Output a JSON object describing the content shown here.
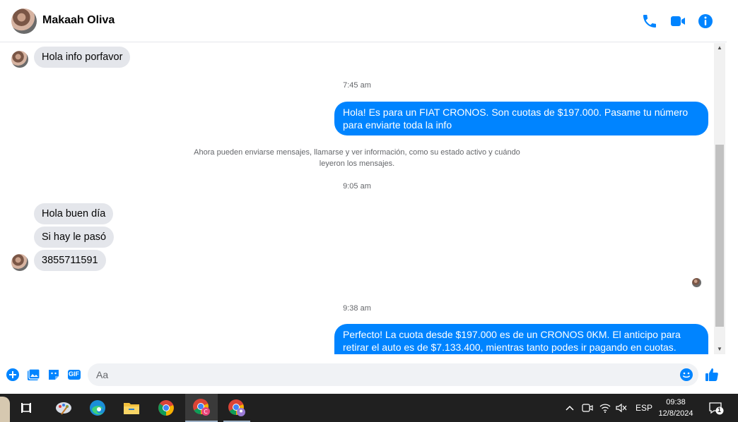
{
  "header": {
    "contact_name": "Makaah Oliva",
    "icons": [
      "phone-icon",
      "video-icon",
      "info-icon"
    ]
  },
  "messages": [
    {
      "dir": "in",
      "text": "Hola info porfavor"
    },
    {
      "type": "time",
      "text": "7:45 am"
    },
    {
      "dir": "out",
      "text": "Hola! Es para un FIAT CRONOS. Son cuotas de $197.000. Pasame tu número para enviarte toda la info"
    },
    {
      "type": "system",
      "text": "Ahora pueden enviarse mensajes, llamarse y ver información, como su estado activo y cuándo leyeron los mensajes."
    },
    {
      "type": "time",
      "text": "9:05 am"
    },
    {
      "dir": "in",
      "text": "Hola buen día"
    },
    {
      "dir": "in",
      "text": "Si hay le pasó"
    },
    {
      "dir": "in",
      "text": "3855711591"
    },
    {
      "type": "time",
      "text": "9:38 am"
    },
    {
      "dir": "out",
      "text": "Perfecto! La cuota desde $197.000 es de un CRONOS 0KM. El anticipo para retirar el auto es de $7.133.400, mientras tanto podes ir pagando en cuotas. Cuándo podes"
    }
  ],
  "composer": {
    "placeholder": "Aa",
    "gif_label": "GIF",
    "accent": "#0084ff"
  },
  "taskbar": {
    "language": "ESP",
    "time": "09:38",
    "date": "12/8/2024",
    "notification_count": "1"
  }
}
